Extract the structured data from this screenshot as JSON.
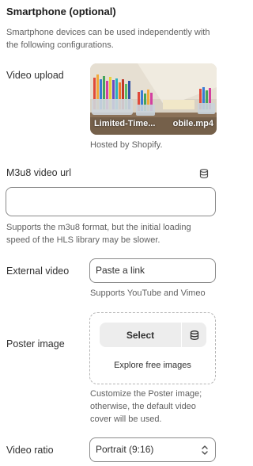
{
  "section": {
    "title": "Smartphone (optional)",
    "description": "Smartphone devices can be used independently with the following configurations."
  },
  "video_upload": {
    "label": "Video upload",
    "file_name_start": "Limited-Time...",
    "file_name_end": "obile.mp4",
    "hosted_note": "Hosted by Shopify."
  },
  "m3u8": {
    "label": "M3u8 video url",
    "value": "",
    "help": "Supports the m3u8 format, but the initial loading speed of the HLS library may be slower."
  },
  "external_video": {
    "label": "External video",
    "placeholder": "Paste a link",
    "help": "Supports YouTube and Vimeo"
  },
  "poster": {
    "label": "Poster image",
    "select_label": "Select",
    "explore_label": "Explore free images",
    "help": "Customize the Poster image; otherwise, the default video cover will be used."
  },
  "video_ratio": {
    "label": "Video ratio",
    "selected": "Portrait (9:16)"
  },
  "icons": {
    "database": "database-icon",
    "chevron": "chevron-up-down-icon"
  }
}
